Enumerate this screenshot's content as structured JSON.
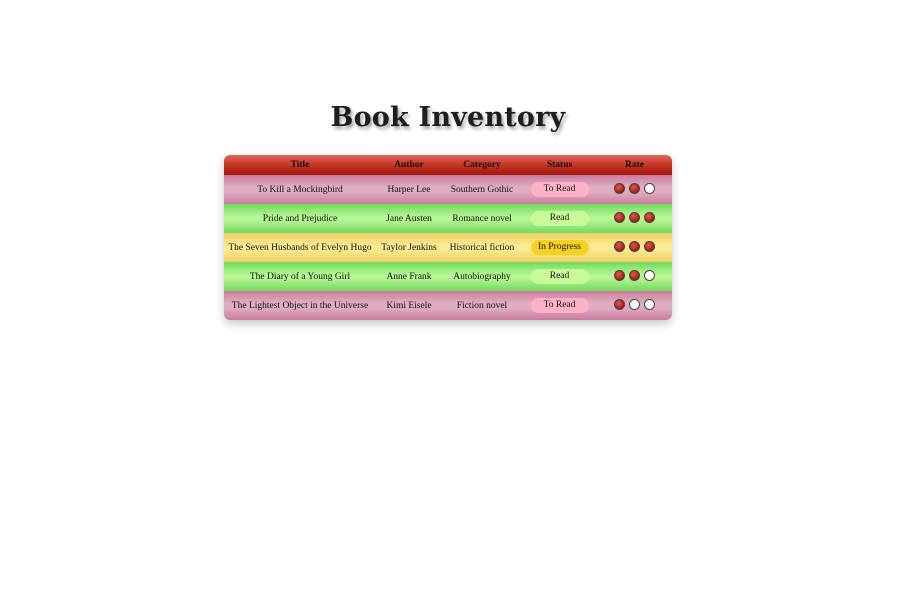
{
  "page": {
    "title": "Book Inventory"
  },
  "table": {
    "headers": {
      "title": "Title",
      "author": "Author",
      "category": "Category",
      "status": "Status",
      "rate": "Rate"
    },
    "rows": [
      {
        "title": "To Kill a Mockingbird",
        "author": "Harper Lee",
        "category": "Southern Gothic",
        "status": "To Read",
        "rating": 2,
        "max_rating": 3
      },
      {
        "title": "Pride and Prejudice",
        "author": "Jane Austen",
        "category": "Romance novel",
        "status": "Read",
        "rating": 3,
        "max_rating": 3
      },
      {
        "title": "The Seven Husbands of Evelyn Hugo",
        "author": "Taylor Jenkins",
        "category": "Historical fiction",
        "status": "In Progress",
        "rating": 3,
        "max_rating": 3
      },
      {
        "title": "The Diary of a Young Girl",
        "author": "Anne Frank",
        "category": "Autobiography",
        "status": "Read",
        "rating": 2,
        "max_rating": 3
      },
      {
        "title": "The Lightest Object in the Universe",
        "author": "Kimi Eisele",
        "category": "Fiction novel",
        "status": "To Read",
        "rating": 1,
        "max_rating": 3
      }
    ]
  },
  "colors": {
    "header": "#c8392b",
    "to_read_row": "#dfacc2",
    "read_row": "#b8f595",
    "in_progress_row": "#fbeb94",
    "to_read_badge": "#ffb1c7",
    "read_badge": "#c9fa9a",
    "in_progress_badge": "#f6d11f",
    "rating_filled": "#b3281d"
  }
}
